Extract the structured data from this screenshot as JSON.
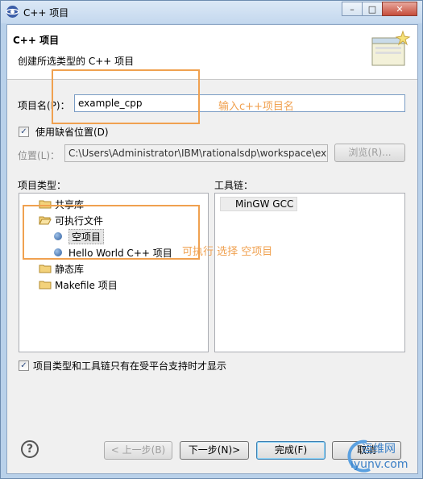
{
  "window": {
    "title": "C++ 项目",
    "controls": {
      "minimize": "–",
      "maximize": "□",
      "close": "✕"
    }
  },
  "banner": {
    "title": "C++ 项目",
    "description": "创建所选类型的 C++ 项目"
  },
  "project_name": {
    "label": "项目名(P)：",
    "value": "example_cpp"
  },
  "use_default_location": {
    "label": "使用缺省位置(D)",
    "checked": true
  },
  "location": {
    "label": "位置(L)：",
    "value": "C:\\Users\\Administrator\\IBM\\rationalsdp\\workspace\\ex",
    "browse_label": "浏览(R)..."
  },
  "project_types": {
    "label": "项目类型：",
    "items": [
      {
        "label": "共享库",
        "icon": "folder-icon"
      },
      {
        "label": "可执行文件",
        "icon": "folder-open-icon"
      },
      {
        "label": "空项目",
        "icon": "dot-icon",
        "selected": true
      },
      {
        "label": "Hello World C++ 项目",
        "icon": "dot-icon"
      },
      {
        "label": "静态库",
        "icon": "folder-icon"
      },
      {
        "label": "Makefile 项目",
        "icon": "folder-icon"
      }
    ]
  },
  "toolchains": {
    "label": "工具链：",
    "items": [
      "MinGW GCC"
    ]
  },
  "filter_checkbox": {
    "label": "项目类型和工具链只有在受平台支持时才显示",
    "checked": true
  },
  "buttons": {
    "help": "?",
    "back": "< 上一步(B)",
    "next": "下一步(N)>",
    "finish": "完成(F)",
    "cancel": "取消"
  },
  "annotations": {
    "name_hint": "输入c++项目名",
    "type_hint": "可执行 选择 空项目"
  },
  "watermark": {
    "line1": "运维网",
    "line2": "iyunv.com"
  },
  "colors": {
    "annotation": "#f0a150",
    "window_frame": "#b9d1ea",
    "dialog_bg": "#f0f0f0"
  }
}
